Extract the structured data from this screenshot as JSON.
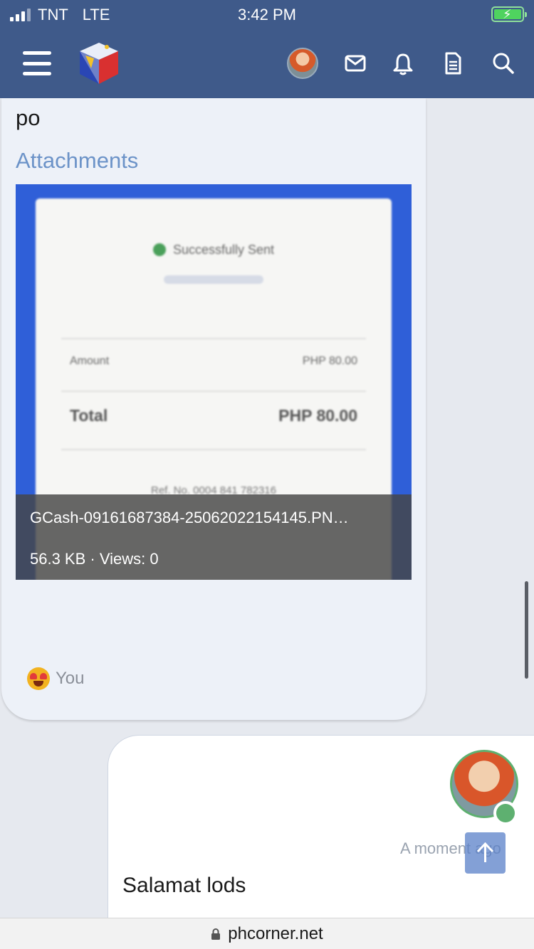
{
  "status_bar": {
    "carrier": "TNT",
    "network": "LTE",
    "time": "3:42 PM",
    "battery_state": "charging"
  },
  "nav": {
    "icons": [
      "menu-icon",
      "site-logo",
      "user-avatar",
      "mail-icon",
      "bell-icon",
      "document-icon",
      "search-icon"
    ],
    "bar_color": "#3f5a8a"
  },
  "post": {
    "text_tail": "po",
    "attachments_title": "Attachments",
    "attachment": {
      "receipt_status": "Successfully Sent",
      "receipt_amount_label": "Amount",
      "receipt_amount_value": "PHP 80.00",
      "receipt_total_label": "Total",
      "receipt_total_value": "PHP 80.00",
      "receipt_ref": "Ref. No. 0004 841 782316",
      "filename": "GCash-09161687384-25062022154145.PN…",
      "meta": "56.3 KB · Views: 0"
    },
    "reaction": {
      "emoji": "heart-eyes",
      "label": "You"
    }
  },
  "reply": {
    "timestamp": "A moment ago",
    "text": "Salamat lods",
    "online": true
  },
  "browser": {
    "url": "phcorner.net"
  }
}
